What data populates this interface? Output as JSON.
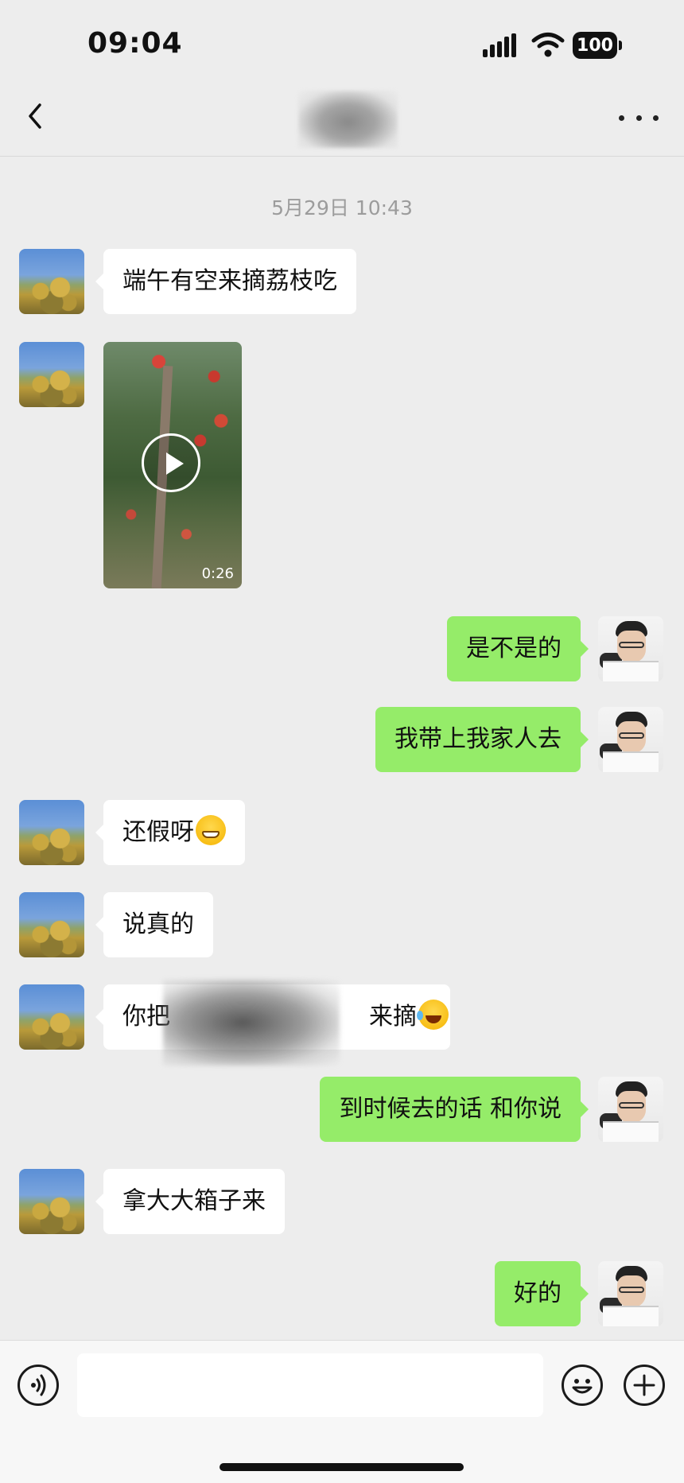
{
  "status_bar": {
    "time": "09:04",
    "battery": "100"
  },
  "chat": {
    "timestamp": "5月29日 10:43",
    "video": {
      "duration": "0:26"
    },
    "messages": [
      {
        "from": "friend",
        "text": "端午有空来摘荔枝吃"
      },
      {
        "from": "me",
        "text": "是不是的"
      },
      {
        "from": "me",
        "text": "我带上我家人去"
      },
      {
        "from": "friend",
        "text": "还假呀"
      },
      {
        "from": "friend",
        "text": "说真的"
      },
      {
        "from": "friend",
        "text_prefix": "你把",
        "text_suffix": "来摘"
      },
      {
        "from": "me",
        "text": "到时候去的话 和你说"
      },
      {
        "from": "friend",
        "text": "拿大大箱子来"
      },
      {
        "from": "me",
        "text": "好的"
      }
    ]
  },
  "input_bar": {
    "message_value": ""
  },
  "colors": {
    "background": "#ededed",
    "outgoing_bubble": "#95ec69",
    "incoming_bubble": "#ffffff"
  },
  "icons": [
    "back-icon",
    "more-icon",
    "signal-icon",
    "wifi-icon",
    "battery-icon",
    "play-icon",
    "voice-icon",
    "emoji-icon",
    "plus-icon"
  ]
}
